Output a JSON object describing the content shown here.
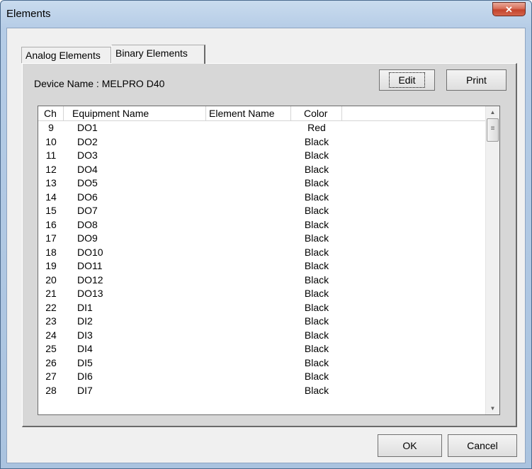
{
  "window": {
    "title": "Elements",
    "close_glyph": "✕"
  },
  "tabs": [
    {
      "label": "Analog Elements"
    },
    {
      "label": "Binary Elements"
    }
  ],
  "device": {
    "label": "Device Name : MELPRO D40"
  },
  "buttons": {
    "edit": "Edit",
    "print": "Print",
    "ok": "OK",
    "cancel": "Cancel"
  },
  "table": {
    "columns": [
      "Ch",
      "Equipment Name",
      "Element Name",
      "Color"
    ],
    "rows": [
      {
        "ch": "9",
        "equipment": "DO1",
        "element": "",
        "color": "Red"
      },
      {
        "ch": "10",
        "equipment": "DO2",
        "element": "",
        "color": "Black"
      },
      {
        "ch": "11",
        "equipment": "DO3",
        "element": "",
        "color": "Black"
      },
      {
        "ch": "12",
        "equipment": "DO4",
        "element": "",
        "color": "Black"
      },
      {
        "ch": "13",
        "equipment": "DO5",
        "element": "",
        "color": "Black"
      },
      {
        "ch": "14",
        "equipment": "DO6",
        "element": "",
        "color": "Black"
      },
      {
        "ch": "15",
        "equipment": "DO7",
        "element": "",
        "color": "Black"
      },
      {
        "ch": "16",
        "equipment": "DO8",
        "element": "",
        "color": "Black"
      },
      {
        "ch": "17",
        "equipment": "DO9",
        "element": "",
        "color": "Black"
      },
      {
        "ch": "18",
        "equipment": "DO10",
        "element": "",
        "color": "Black"
      },
      {
        "ch": "19",
        "equipment": "DO11",
        "element": "",
        "color": "Black"
      },
      {
        "ch": "20",
        "equipment": "DO12",
        "element": "",
        "color": "Black"
      },
      {
        "ch": "21",
        "equipment": "DO13",
        "element": "",
        "color": "Black"
      },
      {
        "ch": "22",
        "equipment": "DI1",
        "element": "",
        "color": "Black"
      },
      {
        "ch": "23",
        "equipment": "DI2",
        "element": "",
        "color": "Black"
      },
      {
        "ch": "24",
        "equipment": "DI3",
        "element": "",
        "color": "Black"
      },
      {
        "ch": "25",
        "equipment": "DI4",
        "element": "",
        "color": "Black"
      },
      {
        "ch": "26",
        "equipment": "DI5",
        "element": "",
        "color": "Black"
      },
      {
        "ch": "27",
        "equipment": "DI6",
        "element": "",
        "color": "Black"
      },
      {
        "ch": "28",
        "equipment": "DI7",
        "element": "",
        "color": "Black"
      }
    ]
  },
  "scrollbar": {
    "up_icon": "▲",
    "down_icon": "▼",
    "grip_icon": "≡"
  }
}
